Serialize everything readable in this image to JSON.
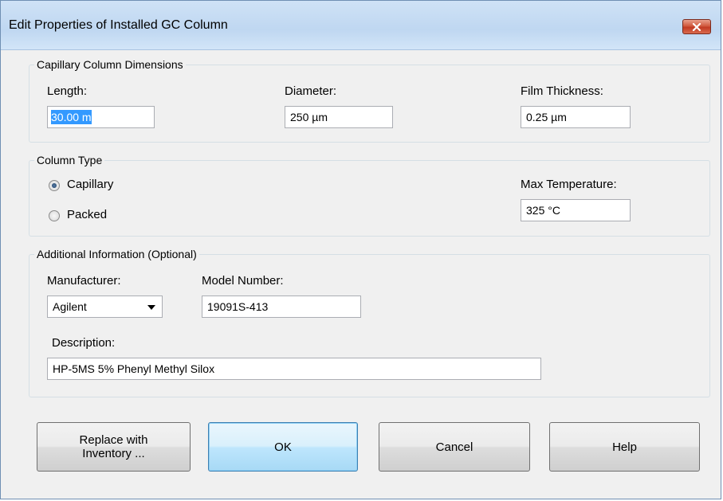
{
  "window": {
    "title": "Edit Properties of Installed GC Column"
  },
  "dimensions": {
    "group_label": "Capillary Column Dimensions",
    "length_label": "Length:",
    "length_value": "30.00 m",
    "diameter_label": "Diameter:",
    "diameter_value": "250 µm",
    "film_label": "Film Thickness:",
    "film_value": "0.25 µm"
  },
  "column_type": {
    "group_label": "Column Type",
    "capillary_label": "Capillary",
    "packed_label": "Packed",
    "selected": "Capillary",
    "max_temp_label": "Max Temperature:",
    "max_temp_value": "325 °C"
  },
  "additional": {
    "group_label": "Additional Information (Optional)",
    "manufacturer_label": "Manufacturer:",
    "manufacturer_value": "Agilent",
    "model_label": "Model Number:",
    "model_value": "19091S-413",
    "description_label": "Description:",
    "description_value": "HP-5MS  5% Phenyl Methyl Silox"
  },
  "buttons": {
    "replace_line1": "Replace with",
    "replace_line2": "Inventory ...",
    "ok": "OK",
    "cancel": "Cancel",
    "help": "Help"
  },
  "colors": {
    "close_button": "#c23a22",
    "selection": "#3399ff",
    "default_button_border": "#3c7fb1"
  }
}
